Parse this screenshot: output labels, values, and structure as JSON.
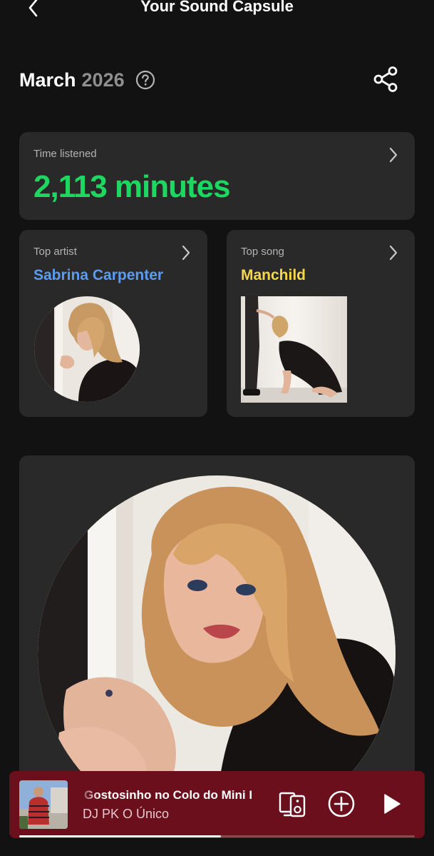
{
  "header": {
    "title": "Your Sound Capsule",
    "back_icon": "chevron-left-icon"
  },
  "period": {
    "month": "March",
    "year": "2026",
    "help_icon": "question-circle-icon",
    "share_icon": "share-icon"
  },
  "time_listened": {
    "label": "Time listened",
    "value": "2,113 minutes",
    "color": "#1ed760"
  },
  "top_artist": {
    "label": "Top artist",
    "name": "Sabrina Carpenter",
    "color": "#5b9cf0"
  },
  "top_song": {
    "label": "Top song",
    "name": "Manchild",
    "color": "#f5d84a"
  },
  "now_playing": {
    "title": "Gostosinho no Colo do Mini I",
    "artist": "DJ PK O Único",
    "progress": 0.51,
    "background_color": "#6a0f1b",
    "icons": [
      "connect-device-icon",
      "add-circle-icon",
      "play-icon"
    ]
  }
}
